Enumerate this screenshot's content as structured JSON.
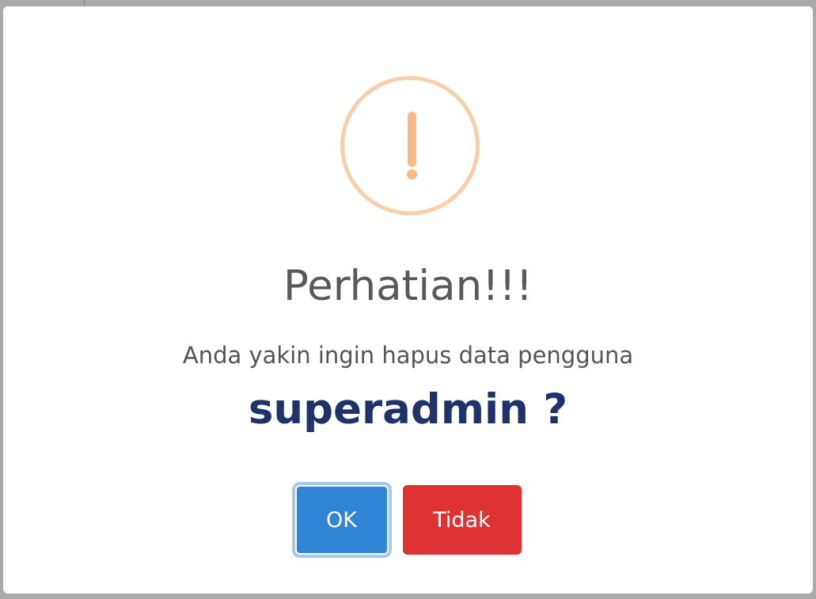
{
  "dialog": {
    "title": "Perhatian!!!",
    "message": "Anda yakin ingin hapus data pengguna",
    "username": "superadmin",
    "question_mark": "?",
    "icon": "warning-icon",
    "confirm_label": "OK",
    "cancel_label": "Tidak"
  },
  "colors": {
    "icon_ring": "#facea8",
    "icon_mark": "#f8bb86",
    "confirm": "#3085d6",
    "cancel": "#dd3333",
    "username": "#1f336b"
  }
}
